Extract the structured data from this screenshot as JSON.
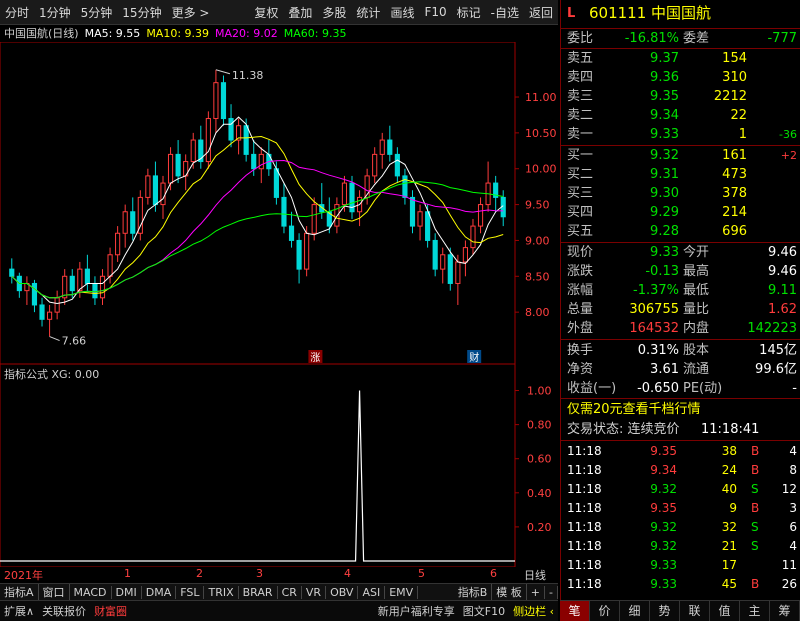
{
  "toolbar": {
    "items_left": [
      "分时",
      "1分钟",
      "5分钟",
      "15分钟",
      "更多 >"
    ],
    "items_right": [
      "复权",
      "叠加",
      "多股",
      "统计",
      "画线",
      "F10",
      "标记",
      "-自选",
      "返回"
    ]
  },
  "main_chart": {
    "title": "中国国航(日线)",
    "ma5_label": "MA5: 9.55",
    "ma10_label": "MA10: 9.39",
    "ma20_label": "MA20: 9.02",
    "ma60_label": "MA60: 9.35",
    "high_mark": "11.38",
    "low_mark": "7.66",
    "y_ticks": [
      "11.00",
      "10.50",
      "10.00",
      "9.50",
      "9.00",
      "8.50",
      "8.00"
    ],
    "badge_zhang": "涨",
    "badge_cai": "财",
    "colors": {
      "up": "#ff3c3c",
      "down": "#00d8d8",
      "ma5": "#ffffff",
      "ma10": "#ffff00",
      "ma20": "#ff00ff",
      "ma60": "#00ff00"
    }
  },
  "indicator": {
    "title": "指标公式 XG: 0.00",
    "y_ticks": [
      "1.00",
      "0.80",
      "0.60",
      "0.40",
      "0.20"
    ]
  },
  "xaxis": {
    "labels": [
      "2021年",
      "1",
      "2",
      "3",
      "4",
      "5",
      "6"
    ],
    "right_label": "日线"
  },
  "chart_data": {
    "type": "candlestick",
    "ylim": [
      7.5,
      11.6
    ],
    "ohlc": [
      [
        8.6,
        8.75,
        8.4,
        8.5
      ],
      [
        8.5,
        8.55,
        8.2,
        8.3
      ],
      [
        8.3,
        8.5,
        8.1,
        8.4
      ],
      [
        8.4,
        8.45,
        8.0,
        8.1
      ],
      [
        8.1,
        8.2,
        7.8,
        7.9
      ],
      [
        7.9,
        8.1,
        7.66,
        8.0
      ],
      [
        8.0,
        8.3,
        7.9,
        8.2
      ],
      [
        8.2,
        8.6,
        8.1,
        8.5
      ],
      [
        8.5,
        8.6,
        8.2,
        8.3
      ],
      [
        8.3,
        8.7,
        8.2,
        8.6
      ],
      [
        8.6,
        8.8,
        8.3,
        8.4
      ],
      [
        8.4,
        8.5,
        8.1,
        8.2
      ],
      [
        8.2,
        8.6,
        8.1,
        8.5
      ],
      [
        8.5,
        8.9,
        8.4,
        8.8
      ],
      [
        8.8,
        9.2,
        8.7,
        9.1
      ],
      [
        9.1,
        9.5,
        8.9,
        9.4
      ],
      [
        9.4,
        9.6,
        9.0,
        9.1
      ],
      [
        9.1,
        9.7,
        9.0,
        9.6
      ],
      [
        9.6,
        10.0,
        9.5,
        9.9
      ],
      [
        9.9,
        10.1,
        9.4,
        9.5
      ],
      [
        9.5,
        9.9,
        9.3,
        9.8
      ],
      [
        9.8,
        10.3,
        9.7,
        10.2
      ],
      [
        10.2,
        10.4,
        9.8,
        9.9
      ],
      [
        9.9,
        10.2,
        9.7,
        10.1
      ],
      [
        10.1,
        10.5,
        10.0,
        10.4
      ],
      [
        10.4,
        10.6,
        10.0,
        10.1
      ],
      [
        10.1,
        10.8,
        10.0,
        10.7
      ],
      [
        10.7,
        11.38,
        10.5,
        11.2
      ],
      [
        11.2,
        11.3,
        10.6,
        10.7
      ],
      [
        10.7,
        10.9,
        10.3,
        10.4
      ],
      [
        10.4,
        10.7,
        10.2,
        10.6
      ],
      [
        10.6,
        10.7,
        10.1,
        10.2
      ],
      [
        10.2,
        10.4,
        9.9,
        10.0
      ],
      [
        10.0,
        10.3,
        9.8,
        10.2
      ],
      [
        10.2,
        10.4,
        9.9,
        10.0
      ],
      [
        10.0,
        10.1,
        9.5,
        9.6
      ],
      [
        9.6,
        9.8,
        9.1,
        9.2
      ],
      [
        9.2,
        9.4,
        8.9,
        9.0
      ],
      [
        9.0,
        9.1,
        8.4,
        8.6
      ],
      [
        8.6,
        9.2,
        8.5,
        9.1
      ],
      [
        9.1,
        9.6,
        9.0,
        9.5
      ],
      [
        9.5,
        9.8,
        9.3,
        9.4
      ],
      [
        9.4,
        9.6,
        9.1,
        9.2
      ],
      [
        9.2,
        9.6,
        9.1,
        9.5
      ],
      [
        9.5,
        9.9,
        9.4,
        9.8
      ],
      [
        9.8,
        9.9,
        9.3,
        9.4
      ],
      [
        9.4,
        9.7,
        9.2,
        9.6
      ],
      [
        9.6,
        10.0,
        9.5,
        9.9
      ],
      [
        9.9,
        10.3,
        9.8,
        10.2
      ],
      [
        10.2,
        10.5,
        10.0,
        10.4
      ],
      [
        10.4,
        10.6,
        10.1,
        10.2
      ],
      [
        10.2,
        10.3,
        9.8,
        9.9
      ],
      [
        9.9,
        10.0,
        9.5,
        9.6
      ],
      [
        9.6,
        9.7,
        9.1,
        9.2
      ],
      [
        9.2,
        9.5,
        9.0,
        9.4
      ],
      [
        9.4,
        9.5,
        8.9,
        9.0
      ],
      [
        9.0,
        9.1,
        8.5,
        8.6
      ],
      [
        8.6,
        8.9,
        8.4,
        8.8
      ],
      [
        8.8,
        8.9,
        8.3,
        8.4
      ],
      [
        8.4,
        8.8,
        8.1,
        8.7
      ],
      [
        8.7,
        9.0,
        8.5,
        8.9
      ],
      [
        8.9,
        9.3,
        8.8,
        9.2
      ],
      [
        9.2,
        9.6,
        9.1,
        9.5
      ],
      [
        9.5,
        10.1,
        9.4,
        9.8
      ],
      [
        9.8,
        9.9,
        9.4,
        9.6
      ],
      [
        9.6,
        9.7,
        9.2,
        9.33
      ]
    ],
    "xg_signal_index": 46
  },
  "stock": {
    "badge": "L",
    "code": "601111",
    "name": "中国国航"
  },
  "order_book": {
    "weibi_label": "委比",
    "weibi": "-16.81%",
    "weicha_label": "委差",
    "weicha": "-777",
    "asks": [
      {
        "label": "卖五",
        "price": "9.37",
        "vol": "154",
        "chg": ""
      },
      {
        "label": "卖四",
        "price": "9.36",
        "vol": "310",
        "chg": ""
      },
      {
        "label": "卖三",
        "price": "9.35",
        "vol": "2212",
        "chg": ""
      },
      {
        "label": "卖二",
        "price": "9.34",
        "vol": "22",
        "chg": ""
      },
      {
        "label": "卖一",
        "price": "9.33",
        "vol": "1",
        "chg": "-36"
      }
    ],
    "bids": [
      {
        "label": "买一",
        "price": "9.32",
        "vol": "161",
        "chg": "+2"
      },
      {
        "label": "买二",
        "price": "9.31",
        "vol": "473",
        "chg": ""
      },
      {
        "label": "买三",
        "price": "9.30",
        "vol": "378",
        "chg": ""
      },
      {
        "label": "买四",
        "price": "9.29",
        "vol": "214",
        "chg": ""
      },
      {
        "label": "买五",
        "price": "9.28",
        "vol": "696",
        "chg": ""
      }
    ]
  },
  "quote": [
    {
      "l1": "现价",
      "v1": "9.33",
      "c1": "green",
      "l2": "今开",
      "v2": "9.46",
      "c2": "white"
    },
    {
      "l1": "涨跌",
      "v1": "-0.13",
      "c1": "green",
      "l2": "最高",
      "v2": "9.46",
      "c2": "white"
    },
    {
      "l1": "涨幅",
      "v1": "-1.37%",
      "c1": "green",
      "l2": "最低",
      "v2": "9.11",
      "c2": "green"
    },
    {
      "l1": "总量",
      "v1": "306755",
      "c1": "yellow",
      "l2": "量比",
      "v2": "1.62",
      "c2": "red"
    },
    {
      "l1": "外盘",
      "v1": "164532",
      "c1": "red",
      "l2": "内盘",
      "v2": "142223",
      "c2": "green"
    }
  ],
  "fin": [
    {
      "l1": "换手",
      "v1": "0.31%",
      "l2": "股本",
      "v2": "145亿"
    },
    {
      "l1": "净资",
      "v1": "3.61",
      "l2": "流通",
      "v2": "99.6亿"
    },
    {
      "l1": "收益(一)",
      "v1": "-0.650",
      "l2": "PE(动)",
      "v2": "-"
    }
  ],
  "promo": "仅需20元查看千档行情",
  "trade_status": "交易状态: 连续竞价",
  "trade_time": "11:18:41",
  "ticks": [
    {
      "t": "11:18",
      "p": "9.35",
      "v": "38",
      "bs": "B",
      "n": "4"
    },
    {
      "t": "11:18",
      "p": "9.34",
      "v": "24",
      "bs": "B",
      "n": "8"
    },
    {
      "t": "11:18",
      "p": "9.32",
      "v": "40",
      "bs": "S",
      "n": "12"
    },
    {
      "t": "11:18",
      "p": "9.35",
      "v": "9",
      "bs": "B",
      "n": "3"
    },
    {
      "t": "11:18",
      "p": "9.32",
      "v": "32",
      "bs": "S",
      "n": "6"
    },
    {
      "t": "11:18",
      "p": "9.32",
      "v": "21",
      "bs": "S",
      "n": "4"
    },
    {
      "t": "11:18",
      "p": "9.33",
      "v": "17",
      "bs": "",
      "n": "11"
    },
    {
      "t": "11:18",
      "p": "9.33",
      "v": "45",
      "bs": "B",
      "n": "26"
    }
  ],
  "tabs1": [
    "指标A",
    "窗口",
    "MACD",
    "DMI",
    "DMA",
    "FSL",
    "TRIX",
    "BRAR",
    "CR",
    "VR",
    "OBV",
    "ASI",
    "EMV"
  ],
  "tabs1_right": [
    "指标B",
    "模 板",
    "+",
    "-"
  ],
  "tabs2": [
    "扩展∧",
    "关联报价",
    "财富圈"
  ],
  "tabs2_right": [
    "新用户福利专享",
    "图文F10",
    "侧边栏 ‹"
  ],
  "rtabs": [
    "笔",
    "价",
    "细",
    "势",
    "联",
    "值",
    "主",
    "筹"
  ]
}
